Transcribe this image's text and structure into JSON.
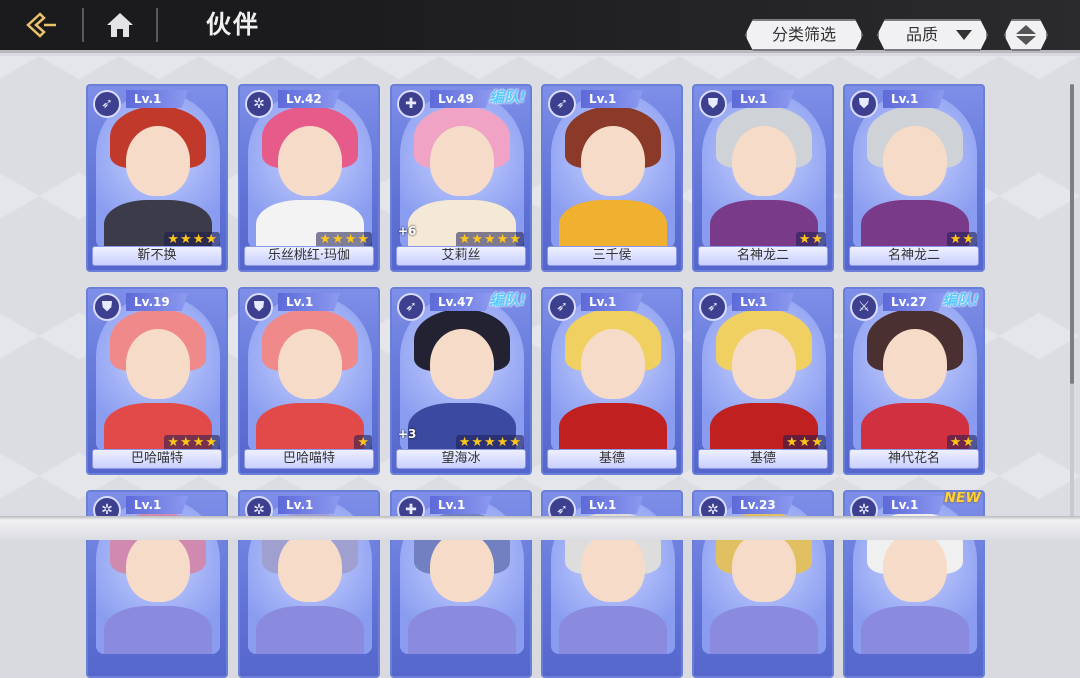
{
  "header": {
    "title": "伙伴",
    "back_icon": "back-arrow-icon",
    "home_icon": "home-icon"
  },
  "toolbar": {
    "filter_label": "分类筛选",
    "quality_label": "品质",
    "sort_icon": "sort-toggle-icon"
  },
  "colors": {
    "header_bg": "#1b1b1d",
    "card_blue": "#6b7fd8",
    "team_tag": "#59c9ff",
    "star": "#ffc61a"
  },
  "cards": [
    {
      "level": "Lv.1",
      "name": "靳不换",
      "stars": 4,
      "class": "bow",
      "tag": "",
      "plus": ""
    },
    {
      "level": "Lv.42",
      "name": "乐丝桃红·玛伽",
      "stars": 4,
      "class": "spirit",
      "tag": "",
      "plus": ""
    },
    {
      "level": "Lv.49",
      "name": "艾莉丝",
      "stars": 5,
      "class": "heal",
      "tag": "编队!",
      "plus": "+6"
    },
    {
      "level": "Lv.1",
      "name": "三千侯",
      "stars": 0,
      "class": "bow",
      "tag": "",
      "plus": ""
    },
    {
      "level": "Lv.1",
      "name": "名神龙二",
      "stars": 2,
      "class": "shield",
      "tag": "",
      "plus": ""
    },
    {
      "level": "Lv.1",
      "name": "名神龙二",
      "stars": 2,
      "class": "shield",
      "tag": "",
      "plus": ""
    },
    {
      "level": "Lv.19",
      "name": "巴哈喵特",
      "stars": 4,
      "class": "shield",
      "tag": "",
      "plus": ""
    },
    {
      "level": "Lv.1",
      "name": "巴哈喵特",
      "stars": 1,
      "class": "shield",
      "tag": "",
      "plus": ""
    },
    {
      "level": "Lv.47",
      "name": "望海冰",
      "stars": 5,
      "class": "bow",
      "tag": "编队!",
      "plus": "+3"
    },
    {
      "level": "Lv.1",
      "name": "基德",
      "stars": 0,
      "class": "bow",
      "tag": "",
      "plus": ""
    },
    {
      "level": "Lv.1",
      "name": "基德",
      "stars": 3,
      "class": "bow",
      "tag": "",
      "plus": ""
    },
    {
      "level": "Lv.27",
      "name": "神代花名",
      "stars": 2,
      "class": "attack",
      "tag": "编队!",
      "plus": ""
    },
    {
      "level": "Lv.1",
      "name": "",
      "stars": 0,
      "class": "spirit",
      "tag": "",
      "plus": ""
    },
    {
      "level": "Lv.1",
      "name": "",
      "stars": 0,
      "class": "spirit",
      "tag": "",
      "plus": ""
    },
    {
      "level": "Lv.1",
      "name": "",
      "stars": 0,
      "class": "heal",
      "tag": "",
      "plus": ""
    },
    {
      "level": "Lv.1",
      "name": "",
      "stars": 0,
      "class": "bow",
      "tag": "",
      "plus": ""
    },
    {
      "level": "Lv.23",
      "name": "",
      "stars": 0,
      "class": "spirit",
      "tag": "",
      "plus": ""
    },
    {
      "level": "Lv.1",
      "name": "",
      "stars": 0,
      "class": "spirit",
      "tag": "NEW",
      "plus": ""
    }
  ]
}
